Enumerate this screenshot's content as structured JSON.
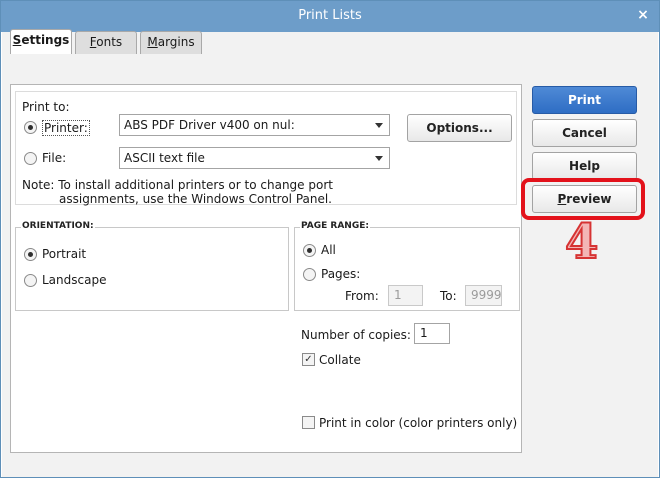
{
  "window": {
    "title": "Print Lists",
    "close_glyph": "×"
  },
  "tabs": [
    {
      "label": "Settings",
      "ul": "S",
      "rest": "ettings"
    },
    {
      "label": "Fonts",
      "ul": "F",
      "rest": "onts"
    },
    {
      "label": "Margins",
      "ul": "M",
      "rest": "argins"
    }
  ],
  "print_to": {
    "label": "Print to:",
    "printer_label": "Printer:",
    "printer_value": "ABS PDF Driver v400 on nul:",
    "file_label": "File:",
    "file_value": "ASCII text file",
    "options_button": "Options...",
    "note_line1": "Note: To install additional printers or to change port",
    "note_line2": "assignments, use the Windows Control Panel."
  },
  "orientation": {
    "title": "ORIENTATION:",
    "portrait": "Portrait",
    "landscape": "Landscape",
    "selected": "portrait"
  },
  "page_range": {
    "title": "PAGE RANGE:",
    "all": "All",
    "pages": "Pages:",
    "from_label": "From:",
    "from_value": "1",
    "to_label": "To:",
    "to_value": "9999"
  },
  "copies": {
    "label": "Number of copies:",
    "value": "1",
    "collate_label": "Collate",
    "collate_checked": true,
    "color_label": "Print in color (color printers only)",
    "color_checked": false
  },
  "buttons": {
    "print": "Print",
    "cancel": "Cancel",
    "help": "Help",
    "preview": "Preview"
  },
  "annotation": {
    "step_number": "4",
    "highlight_color": "#e3121b"
  },
  "colors": {
    "titlebar": "#6d9dc9",
    "primary_button": "#2e6dc4"
  }
}
